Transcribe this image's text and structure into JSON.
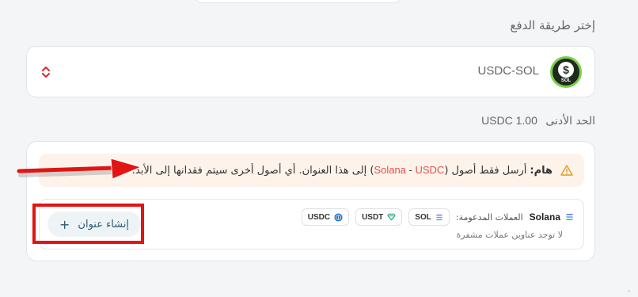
{
  "payment": {
    "section_title": "إختر طريقة الدفع",
    "selected_currency": "USDC-SOL",
    "logo_text": "SOL"
  },
  "minimum": {
    "label": "الحد الأدنى",
    "value": "1.00 USDC"
  },
  "warning": {
    "bold": "هام:",
    "text_before": "أرسل فقط أصول (",
    "asset_a": "Solana",
    "separator": " - ",
    "asset_b": "USDC",
    "text_after": ") إلى هذا العنوان. أي أصول أخرى سيتم فقدانها إلى الأبد."
  },
  "network": {
    "name": "Solana",
    "supported_label": "العملات المدعومة:",
    "tokens": [
      {
        "symbol": "SOL",
        "icon": "solana-icon"
      },
      {
        "symbol": "USDT",
        "icon": "tether-icon"
      },
      {
        "symbol": "USDC",
        "icon": "usdc-icon"
      }
    ],
    "no_addresses": "لا توجد عناوين عملات مشفرة",
    "create_button": "إنشاء عنوان",
    "create_icon": "+"
  },
  "colors": {
    "warning_bg": "#fdf3ea",
    "highlight_red": "#e05252",
    "annotation_red": "#e21414",
    "button_text": "#2b5a75"
  }
}
